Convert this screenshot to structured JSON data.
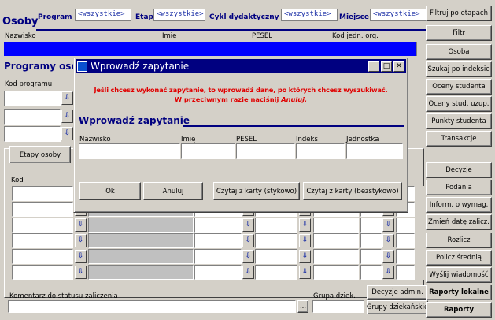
{
  "header": {
    "title": "Osoby",
    "filters": [
      {
        "label": "Program",
        "value": "<wszystkie>"
      },
      {
        "label": "Etap",
        "value": "<wszystkie>"
      },
      {
        "label": "Cykl dydaktyczny",
        "value": "<wszystkie>"
      },
      {
        "label": "Miejsce",
        "value": "<wszystkie>"
      }
    ]
  },
  "persons_grid": {
    "columns": [
      "Nazwisko",
      "Imię",
      "PESEL",
      "Kod jedn. org."
    ]
  },
  "programs": {
    "title": "Programy oso",
    "code_label": "Kod programu"
  },
  "stages": {
    "tab_label": "Etapy osoby",
    "code_label": "Kod",
    "comment_label": "Komentarz do statusu zaliczenia",
    "group_label": "Grupa dziek.",
    "ellipsis": "..."
  },
  "right_buttons": [
    "Filtruj po etapach",
    "Filtr",
    "Osoba",
    "Szukaj po indeksie",
    "Oceny studenta",
    "Oceny stud. uzup.",
    "Punkty studenta",
    "Transakcje",
    "Decyzje",
    "Podania",
    "Inform. o wymag.",
    "Zmień datę zalicz.",
    "Rozlicz",
    "Policz średnią",
    "Wyślij wiadomość",
    "Raporty lokalne",
    "Raporty"
  ],
  "bottom_buttons": [
    "Decyzje admin.",
    "Grupy dziekańskie"
  ],
  "dialog": {
    "title": "Wprowadź zapytanie",
    "info_line1": "Jeśli chcesz wykonać zapytanie, to wprowadź dane, po których chcesz wyszukiwać.",
    "info_line2_prefix": "W przeciwnym razie naciśnij",
    "info_line2_emph": "Anuluj.",
    "section_title": "Wprowadź zapytanie",
    "fields": [
      "Nazwisko",
      "Imię",
      "PESEL",
      "Indeks",
      "Jednostka"
    ],
    "buttons": [
      "Ok",
      "Anuluj",
      "Czytaj z karty (stykowo)",
      "Czytaj z karty (bezstykowo)"
    ]
  },
  "colors": {
    "accent": "#000080",
    "dialog_text": "#e00000",
    "combo_text": "#1b2fa6",
    "selection": "#0000ff"
  }
}
